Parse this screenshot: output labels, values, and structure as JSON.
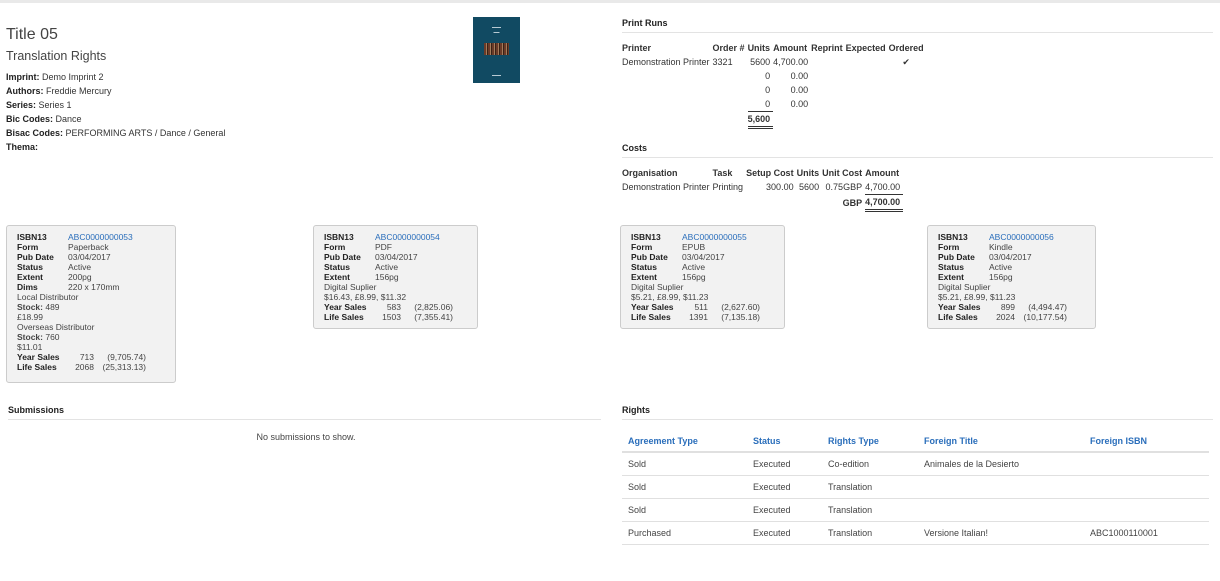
{
  "title": {
    "main": "Title 05",
    "sub": "Translation Rights",
    "meta": [
      {
        "label": "Imprint:",
        "value": "Demo Imprint 2"
      },
      {
        "label": "Authors:",
        "value": "Freddie Mercury"
      },
      {
        "label": "Series:",
        "value": "Series 1"
      },
      {
        "label": "Bic Codes:",
        "value": "Dance"
      },
      {
        "label": "Bisac Codes:",
        "value": "PERFORMING ARTS / Dance / General"
      },
      {
        "label": "Thema:",
        "value": ""
      }
    ]
  },
  "print_runs": {
    "heading": "Print Runs",
    "headers": {
      "printer": "Printer",
      "order": "Order #",
      "units": "Units",
      "amount": "Amount",
      "reprint": "Reprint",
      "expected": "Expected",
      "ordered": "Ordered"
    },
    "rows": [
      {
        "printer": "Demonstration Printer",
        "order": "3321",
        "units": "5600",
        "amount": "4,700.00",
        "ordered": "✔"
      },
      {
        "printer": "",
        "order": "",
        "units": "0",
        "amount": "0.00",
        "ordered": ""
      },
      {
        "printer": "",
        "order": "",
        "units": "0",
        "amount": "0.00",
        "ordered": ""
      },
      {
        "printer": "",
        "order": "",
        "units": "0",
        "amount": "0.00",
        "ordered": ""
      }
    ],
    "total_units": "5,600"
  },
  "costs": {
    "heading": "Costs",
    "headers": {
      "org": "Organisation",
      "task": "Task",
      "setup": "Setup Cost",
      "units": "Units",
      "unit_cost": "Unit Cost",
      "amount": "Amount"
    },
    "row": {
      "org": "Demonstration Printer",
      "task": "Printing",
      "setup": "300.00",
      "units": "5600",
      "unit_cost": "0.75GBP",
      "amount": "4,700.00"
    },
    "total_currency": "GBP",
    "total_amount": "4,700.00"
  },
  "labels": {
    "isbn": "ISBN13",
    "form": "Form",
    "pubdate": "Pub Date",
    "status": "Status",
    "extent": "Extent",
    "dims": "Dims",
    "stock": "Stock:",
    "year_sales": "Year Sales",
    "life_sales": "Life Sales"
  },
  "products": [
    {
      "isbn": "ABC0000000053",
      "form": "Paperback",
      "pubdate": "03/04/2017",
      "status": "Active",
      "extent": "200pg",
      "dims": "220 x 170mm",
      "dist1": "Local Distributor",
      "stock1": " 489",
      "price1": "£18.99",
      "dist2": "Overseas Distributor",
      "stock2": " 760",
      "price2": "$11.01",
      "year_units": "713",
      "year_amount": "(9,705.74)",
      "life_units": "2068",
      "life_amount": "(25,313.13)"
    },
    {
      "isbn": "ABC0000000054",
      "form": "PDF",
      "pubdate": "03/04/2017",
      "status": "Active",
      "extent": "156pg",
      "supplier": "Digital Suplier",
      "prices": "$16.43, £8.99, $11.32",
      "year_units": "583",
      "year_amount": "(2,825.06)",
      "life_units": "1503",
      "life_amount": "(7,355.41)"
    },
    {
      "isbn": "ABC0000000055",
      "form": "EPUB",
      "pubdate": "03/04/2017",
      "status": "Active",
      "extent": "156pg",
      "supplier": "Digital Suplier",
      "prices": "$5.21, £8.99, $11.23",
      "year_units": "511",
      "year_amount": "(2,627.60)",
      "life_units": "1391",
      "life_amount": "(7,135.18)"
    },
    {
      "isbn": "ABC0000000056",
      "form": "Kindle",
      "pubdate": "03/04/2017",
      "status": "Active",
      "extent": "156pg",
      "supplier": "Digital Suplier",
      "prices": "$5.21, £8.99, $11.23",
      "year_units": "899",
      "year_amount": "(4,494.47)",
      "life_units": "2024",
      "life_amount": "(10,177.54)"
    }
  ],
  "submissions": {
    "heading": "Submissions",
    "empty": "No submissions to show."
  },
  "rights": {
    "heading": "Rights",
    "headers": {
      "agreement": "Agreement Type",
      "status": "Status",
      "type": "Rights Type",
      "title": "Foreign Title",
      "isbn": "Foreign ISBN"
    },
    "rows": [
      {
        "agreement": "Sold",
        "status": "Executed",
        "type": "Co-edition",
        "title": "Animales de la Desierto",
        "isbn": ""
      },
      {
        "agreement": "Sold",
        "status": "Executed",
        "type": "Translation",
        "title": "",
        "isbn": ""
      },
      {
        "agreement": "Sold",
        "status": "Executed",
        "type": "Translation",
        "title": "",
        "isbn": ""
      },
      {
        "agreement": "Purchased",
        "status": "Executed",
        "type": "Translation",
        "title": "Versione Italian!",
        "isbn": "ABC1000110001"
      }
    ]
  },
  "colors": {
    "link": "#2a6ebb",
    "cover": "#114a62"
  }
}
